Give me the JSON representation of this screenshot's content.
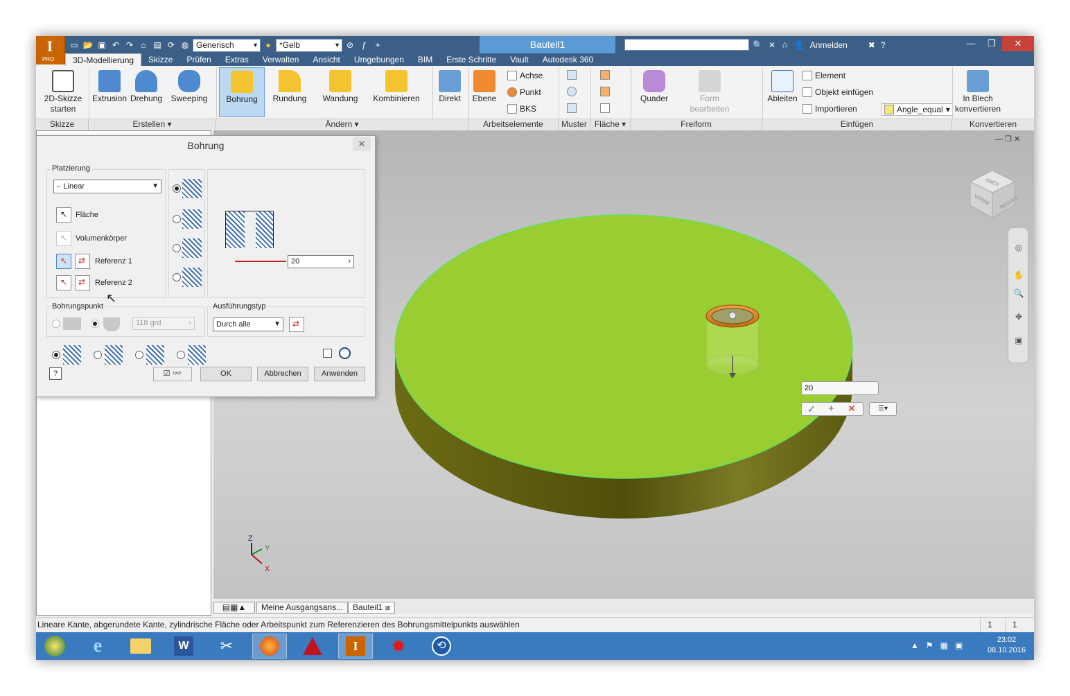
{
  "app": {
    "title": "Bauteil1",
    "logo_sub": "PRO",
    "material_combo": "Generisch",
    "color_combo": "*Gelb",
    "signin": "Anmelden"
  },
  "tabs": [
    "3D-Modellierung",
    "Skizze",
    "Prüfen",
    "Extras",
    "Verwalten",
    "Ansicht",
    "Umgebungen",
    "BIM",
    "Erste Schritte",
    "Vault",
    "Autodesk 360"
  ],
  "ribbon": {
    "sketch_btn": "2D-Skizze",
    "sketch_btn2": "starten",
    "extrusion": "Extrusion",
    "drehung": "Drehung",
    "sweeping": "Sweeping",
    "bohrung": "Bohrung",
    "rundung": "Rundung",
    "wandung": "Wandung",
    "kombinieren": "Kombinieren",
    "direkt": "Direkt",
    "ebene": "Ebene",
    "achse": "Achse",
    "punkt": "Punkt",
    "bks": "BKS",
    "quader": "Quader",
    "form1": "Form",
    "form2": "bearbeiten",
    "ableiten": "Ableiten",
    "element": "Element",
    "objekt": "Objekt einfügen",
    "importieren": "Importieren",
    "angle": "Angle_equal",
    "blech1": "In Blech",
    "blech2": "konvertieren",
    "panels": {
      "skizze": "Skizze",
      "erstellen": "Erstellen",
      "aendern": "Ändern",
      "arbeitselemente": "Arbeitselemente",
      "muster": "Muster",
      "flaeche": "Fläche",
      "freiform": "Freiform",
      "einfuegen": "Einfügen",
      "konvertieren": "Konvertieren"
    }
  },
  "dialog": {
    "title": "Bohrung",
    "placement_group": "Platzierung",
    "placement_value": "Linear",
    "flaeche": "Fläche",
    "volumenkoerper": "Volumenkörper",
    "referenz1": "Referenz 1",
    "referenz2": "Referenz 2",
    "diameter": "20",
    "bohrungspunkt": "Bohrungspunkt",
    "angle": "118 grd",
    "ausfuehrungstyp": "Ausführungstyp",
    "ausfuehrung_value": "Durch alle",
    "ok": "OK",
    "abbrechen": "Abbrechen",
    "anwenden": "Anwenden"
  },
  "viewport": {
    "mini_value": "20",
    "viewcube_top": "OBEN",
    "viewcube_front": "VORNE",
    "viewcube_right": "RECHTS",
    "axis_x": "X",
    "axis_y": "Y",
    "axis_z": "Z"
  },
  "bottom_tabs": [
    "Meine Ausgangsans...",
    "Bauteil1"
  ],
  "status": {
    "message": "Lineare Kante, abgerundete Kante, zylindrische Fläche oder Arbeitspunkt zum Referenzieren des Bohrungsmittelpunkts auswählen",
    "n1": "1",
    "n2": "1"
  },
  "taskbar": {
    "time": "23:02",
    "date": "08.10.2016"
  },
  "colors": {
    "disc_top": "#9acd32",
    "disc_side": "#6b6b12",
    "accent": "#5b9bd5",
    "taskbar": "#3a7bbf"
  }
}
